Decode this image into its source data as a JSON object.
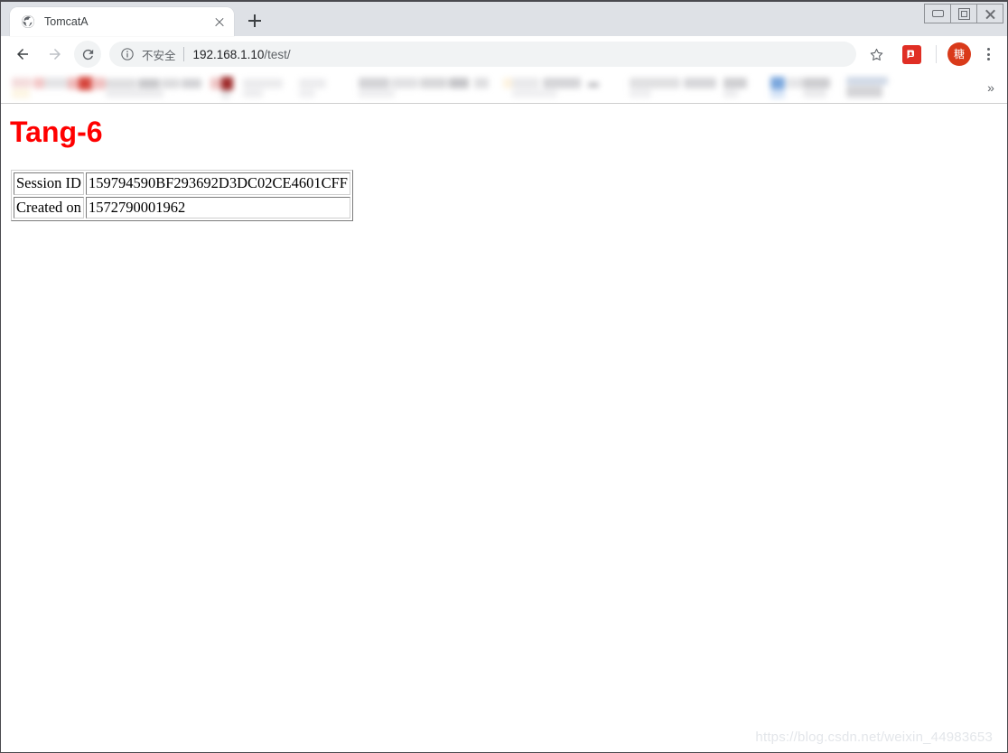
{
  "window": {
    "controls": {
      "minimize_label": "Minimize",
      "maximize_label": "Restore",
      "close_label": "Close"
    }
  },
  "tabstrip": {
    "tabs": [
      {
        "title": "TomcatA",
        "favicon": "globe-icon",
        "close_label": "Close tab"
      }
    ],
    "new_tab_label": "New Tab"
  },
  "toolbar": {
    "back_label": "Back",
    "forward_label": "Forward",
    "reload_label": "Reload",
    "bookmark_label": "Bookmark this page",
    "extension_label": "Extension",
    "avatar_initial": "糖",
    "menu_label": "Customize and control Google Chrome",
    "omnibox": {
      "security_icon": "info-circle-icon",
      "security_text": "不安全",
      "url_host": "192.168.1.10",
      "url_path": "/test/",
      "full_url": "192.168.1.10/test/"
    }
  },
  "bookmarks_bar": {
    "overflow_label": "»",
    "items_blurred": true
  },
  "page": {
    "heading": "Tang-6",
    "table": {
      "rows": [
        {
          "label": "Session ID",
          "value": "159794590BF293692D3DC02CE4601CFF"
        },
        {
          "label": "Created on",
          "value": "1572790001962"
        }
      ]
    },
    "watermark": "https://blog.csdn.net/weixin_44983653"
  },
  "colors": {
    "heading": "#ff0000",
    "tabstrip_bg": "#dee1e6",
    "avatar_bg": "#d93a1a",
    "extension_bg": "#e02e24"
  }
}
